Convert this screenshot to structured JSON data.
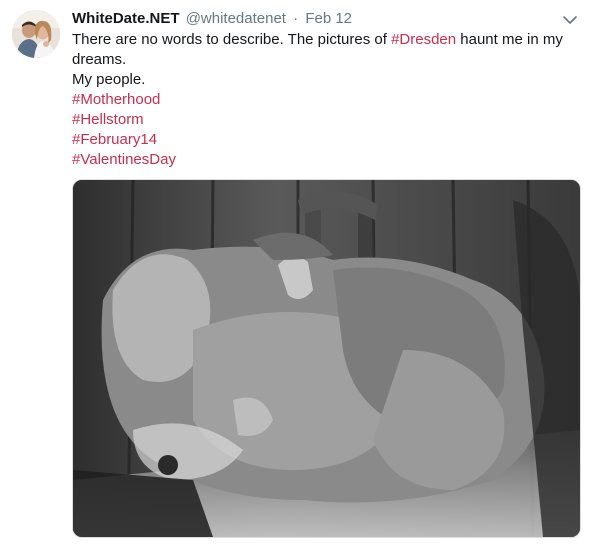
{
  "tweet": {
    "display_name": "WhiteDate.NET",
    "handle": "@whitedatenet",
    "separator": "·",
    "timestamp": "Feb 12",
    "text": {
      "line1_before": "There are no words to describe. The pictures of ",
      "line1_hashtag": "#Dresden",
      "line1_after": " haunt me in my dreams.",
      "line2": "My people.",
      "hashtags": [
        "#Motherhood",
        "#Hellstorm",
        "#February14",
        "#ValentinesDay"
      ]
    },
    "media": {
      "type": "photo",
      "tone": "black-and-white"
    }
  },
  "colors": {
    "hashtag": "#c72f4e",
    "name": "#14171a",
    "meta": "#657786"
  },
  "icons": {
    "menu": "chevron-down-icon"
  }
}
